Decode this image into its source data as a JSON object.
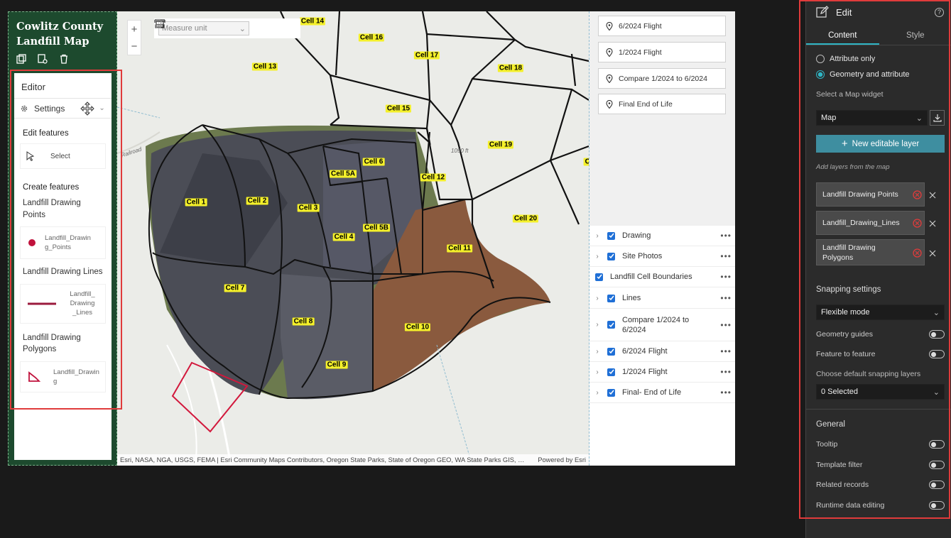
{
  "app": {
    "title": "Cowlitz County Landfill Map"
  },
  "editor": {
    "title": "Editor",
    "settings_label": "Settings",
    "edit_features_label": "Edit features",
    "select_label": "Select",
    "create_features_label": "Create features",
    "layers": [
      {
        "title": "Landfill Drawing Points",
        "template": "Landfill_Drawing_Points"
      },
      {
        "title": "Landfill Drawing Lines",
        "template": "Landfill_Drawing_Lines"
      },
      {
        "title": "Landfill Drawing Polygons",
        "template": "Landfill_Drawing"
      }
    ],
    "colors": {
      "accent": "#c0123c"
    }
  },
  "map": {
    "measure_placeholder": "Measure unit",
    "attribution": "Esri, NASA, NGA, USGS, FEMA | Esri Community Maps Contributors, Oregon State Parks, State of Oregon GEO, WA State Parks GIS, …",
    "powered_by": "Powered by Esri",
    "elevation_label": "1090 ft",
    "road_label": "Railroad",
    "cells": [
      "Cell 14",
      "Cell 16",
      "Cell 17",
      "Cell 13",
      "Cell 18",
      "Cell 15",
      "Cell 19",
      "Cell 6",
      "Cell 5A",
      "Cell 12",
      "Cell 1",
      "Cell 2",
      "Cell 3",
      "Cell 5B",
      "Cell 4",
      "Cell 20",
      "Cell 11",
      "Cell 7",
      "Cell 8",
      "Cell 10",
      "Cell 9",
      "Ce"
    ]
  },
  "bookmarks": [
    "6/2024 Flight",
    "1/2024 Flight",
    "Compare 1/2024 to 6/2024",
    "Final End of Life"
  ],
  "layers": [
    {
      "name": "Drawing",
      "expandable": true
    },
    {
      "name": "Site Photos",
      "expandable": true
    },
    {
      "name": "Landfill Cell Boundaries",
      "expandable": false
    },
    {
      "name": "Lines",
      "expandable": true
    },
    {
      "name": "Compare 1/2024 to 6/2024",
      "expandable": true
    },
    {
      "name": "6/2024 Flight",
      "expandable": true
    },
    {
      "name": "1/2024 Flight",
      "expandable": true
    },
    {
      "name": "Final- End of Life",
      "expandable": true
    }
  ],
  "settings_panel": {
    "title": "Edit",
    "tabs": [
      "Content",
      "Style"
    ],
    "modes": [
      "Attribute only",
      "Geometry and attribute"
    ],
    "select_widget_label": "Select a Map widget",
    "map_widget_value": "Map",
    "new_layer_button": "New editable layer",
    "add_layers_hint": "Add layers from the map",
    "layers": [
      "Landfill Drawing Points",
      "Landfill_Drawing_Lines",
      "Landfill Drawing Polygons"
    ],
    "snapping_title": "Snapping settings",
    "snapping_mode": "Flexible mode",
    "geometry_guides": "Geometry guides",
    "feature_to_feature": "Feature to feature",
    "default_snapping_label": "Choose default snapping layers",
    "snapping_selected": "0 Selected",
    "general_title": "General",
    "general_toggles": [
      "Tooltip",
      "Template filter",
      "Related records",
      "Runtime data editing"
    ],
    "colors": {
      "accent": "#2fb5c5",
      "button": "#3e8ea0",
      "highlight": "#e03b3b"
    }
  }
}
